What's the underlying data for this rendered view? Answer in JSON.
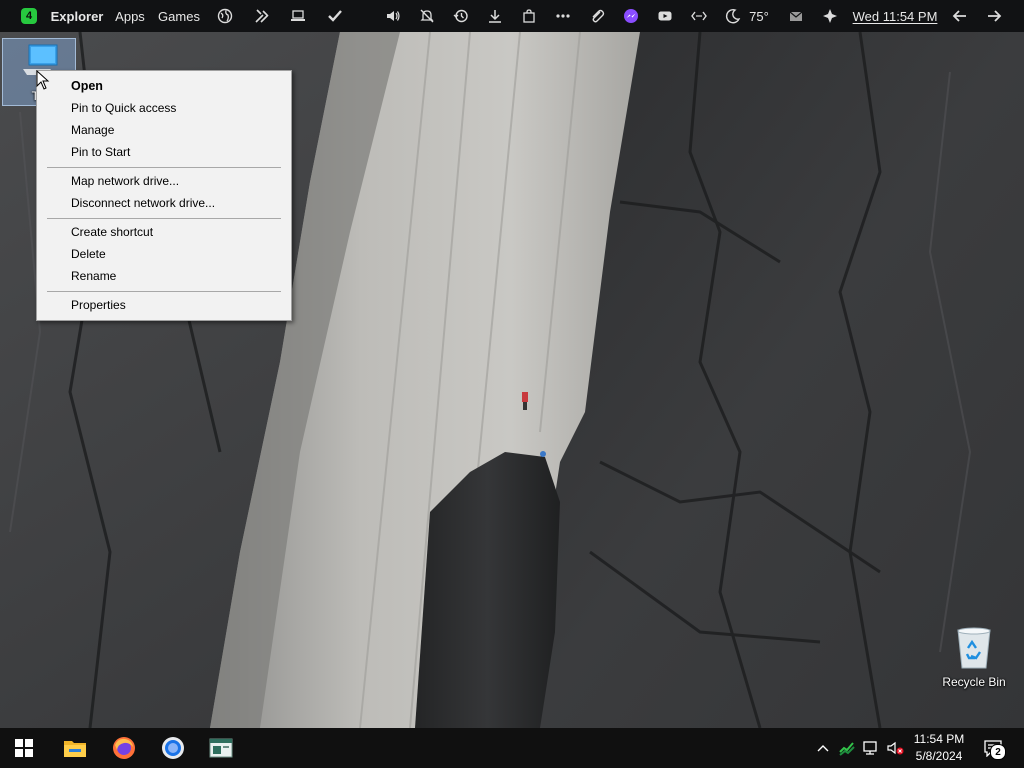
{
  "topbar": {
    "workspace_number": "4",
    "menu": [
      "Explorer",
      "Apps",
      "Games"
    ],
    "weather_temp": "75°",
    "clock": "Wed 11:54 PM",
    "icons": [
      "globe-icon",
      "tools-icon",
      "laptop-icon",
      "checkmark-icon",
      "volume-icon",
      "bell-muted-icon",
      "history-icon",
      "download-icon",
      "shopping-bag-icon",
      "more-dots-icon",
      "paperclip-icon",
      "messenger-icon",
      "youtube-icon",
      "code-icon",
      "moon-icon",
      "mail-icon",
      "sparkle-icon",
      "back-arrow-icon",
      "forward-arrow-icon"
    ]
  },
  "desktop": {
    "this_pc_label": "Thi",
    "recycle_bin_label": "Recycle Bin"
  },
  "context_menu": {
    "items": [
      "Open",
      "Pin to Quick access",
      "Manage",
      "Pin to Start",
      "Map network drive...",
      "Disconnect network drive...",
      "Create shortcut",
      "Delete",
      "Rename",
      "Properties"
    ]
  },
  "taskbar": {
    "pinned": [
      "file-explorer-icon",
      "firefox-icon",
      "chrome-icon",
      "terminal-window-icon"
    ],
    "tray_time": "11:54 PM",
    "tray_date": "5/8/2024",
    "notification_count": "2"
  },
  "colors": {
    "topbar_bg": "#111214",
    "workspace_badge": "#27c93f",
    "menu_bg": "#f2f2f2",
    "taskbar_bg": "#101010",
    "selection": "#8cb4e6"
  }
}
